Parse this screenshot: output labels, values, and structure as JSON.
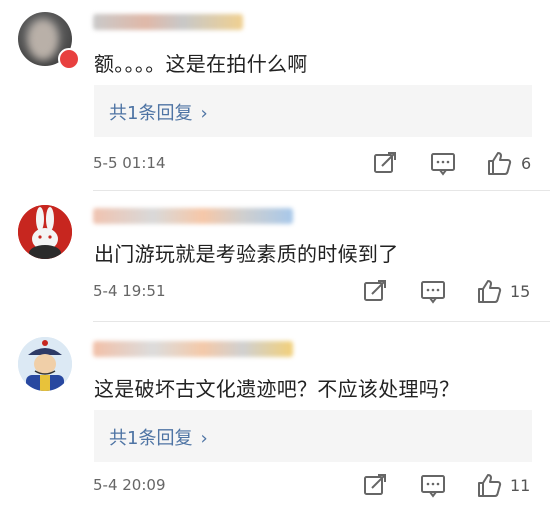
{
  "comments": [
    {
      "text": "额。。。。这是在拍什么啊",
      "reply_label": "共1条回复",
      "reply_chevron": "›",
      "time": "5-5 01:14",
      "like_count": "6"
    },
    {
      "text": "出门游玩就是考验素质的时候到了",
      "time": "5-4 19:51",
      "like_count": "15"
    },
    {
      "text": "这是破坏古文化遗迹吧？不应该处理吗？",
      "reply_label": "共1条回复",
      "reply_chevron": "›",
      "time": "5-4 20:09",
      "like_count": "11"
    }
  ],
  "icons": {
    "share": "share-icon",
    "comment": "comment-icon",
    "like": "thumbs-up-icon"
  },
  "colors": {
    "link": "#4e74a4",
    "vip_badge": "#e8403f",
    "icon_gray": "#666666"
  }
}
